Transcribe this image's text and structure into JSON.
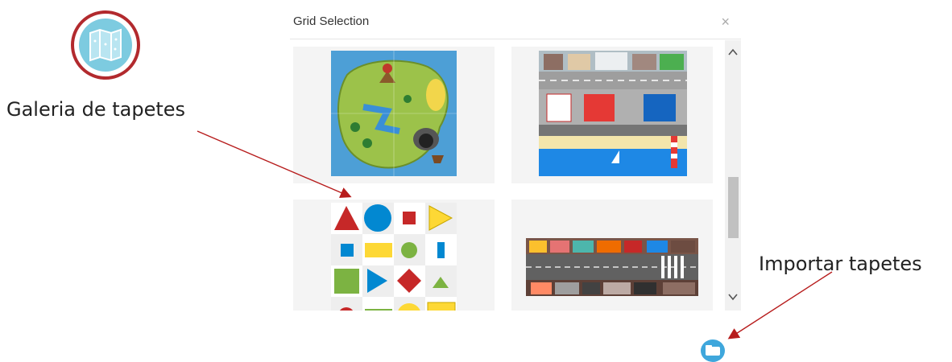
{
  "annotations": {
    "gallery_label": "Galeria de tapetes",
    "import_label": "Importar tapetes",
    "arrow_color": "#b71c1c"
  },
  "dialog": {
    "title": "Grid Selection",
    "close_glyph": "×",
    "tiles": [
      {
        "name": "island-map",
        "icon": "island-map-image"
      },
      {
        "name": "city-beach-map",
        "icon": "city-beach-image"
      },
      {
        "name": "shapes-grid",
        "icon": "shapes-grid-image"
      },
      {
        "name": "street-map",
        "icon": "street-image"
      }
    ]
  },
  "colors": {
    "accent_blue": "#3fa7dc",
    "gallery_ring": "#b22a2e"
  }
}
